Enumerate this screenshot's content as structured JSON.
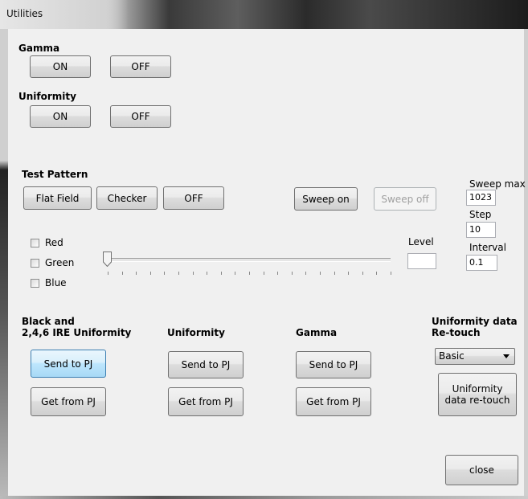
{
  "window": {
    "title": "Utilities"
  },
  "gamma": {
    "header": "Gamma",
    "on_label": "ON",
    "off_label": "OFF"
  },
  "uniformity_toggle": {
    "header": "Uniformity",
    "on_label": "ON",
    "off_label": "OFF"
  },
  "test_pattern": {
    "header": "Test Pattern",
    "flat_field_label": "Flat Field",
    "checker_label": "Checker",
    "off_label": "OFF",
    "sweep_on_label": "Sweep on",
    "sweep_off_label": "Sweep off"
  },
  "sweep": {
    "max_label": "Sweep max",
    "max_value": "1023",
    "step_label": "Step",
    "step_value": "10",
    "interval_label": "Interval",
    "interval_value": "0.1"
  },
  "channels": [
    {
      "label": "Red",
      "checked": false
    },
    {
      "label": "Green",
      "checked": false
    },
    {
      "label": "Blue",
      "checked": false
    }
  ],
  "level": {
    "label": "Level",
    "value": "",
    "slider_fraction": 0.0
  },
  "sections": {
    "black": {
      "header_line1": "Black and",
      "header_line2": "2,4,6 IRE Uniformity",
      "send_label": "Send to PJ",
      "get_label": "Get from PJ"
    },
    "uniformity": {
      "header": "Uniformity",
      "send_label": "Send to PJ",
      "get_label": "Get from PJ"
    },
    "gamma": {
      "header": "Gamma",
      "send_label": "Send to PJ",
      "get_label": "Get from PJ"
    },
    "retouch": {
      "header_line1": "Uniformity data",
      "header_line2": "Re-touch",
      "selected_option": "Basic",
      "button_line1": "Uniformity",
      "button_line2": "data re-touch"
    }
  },
  "close_label": "close"
}
